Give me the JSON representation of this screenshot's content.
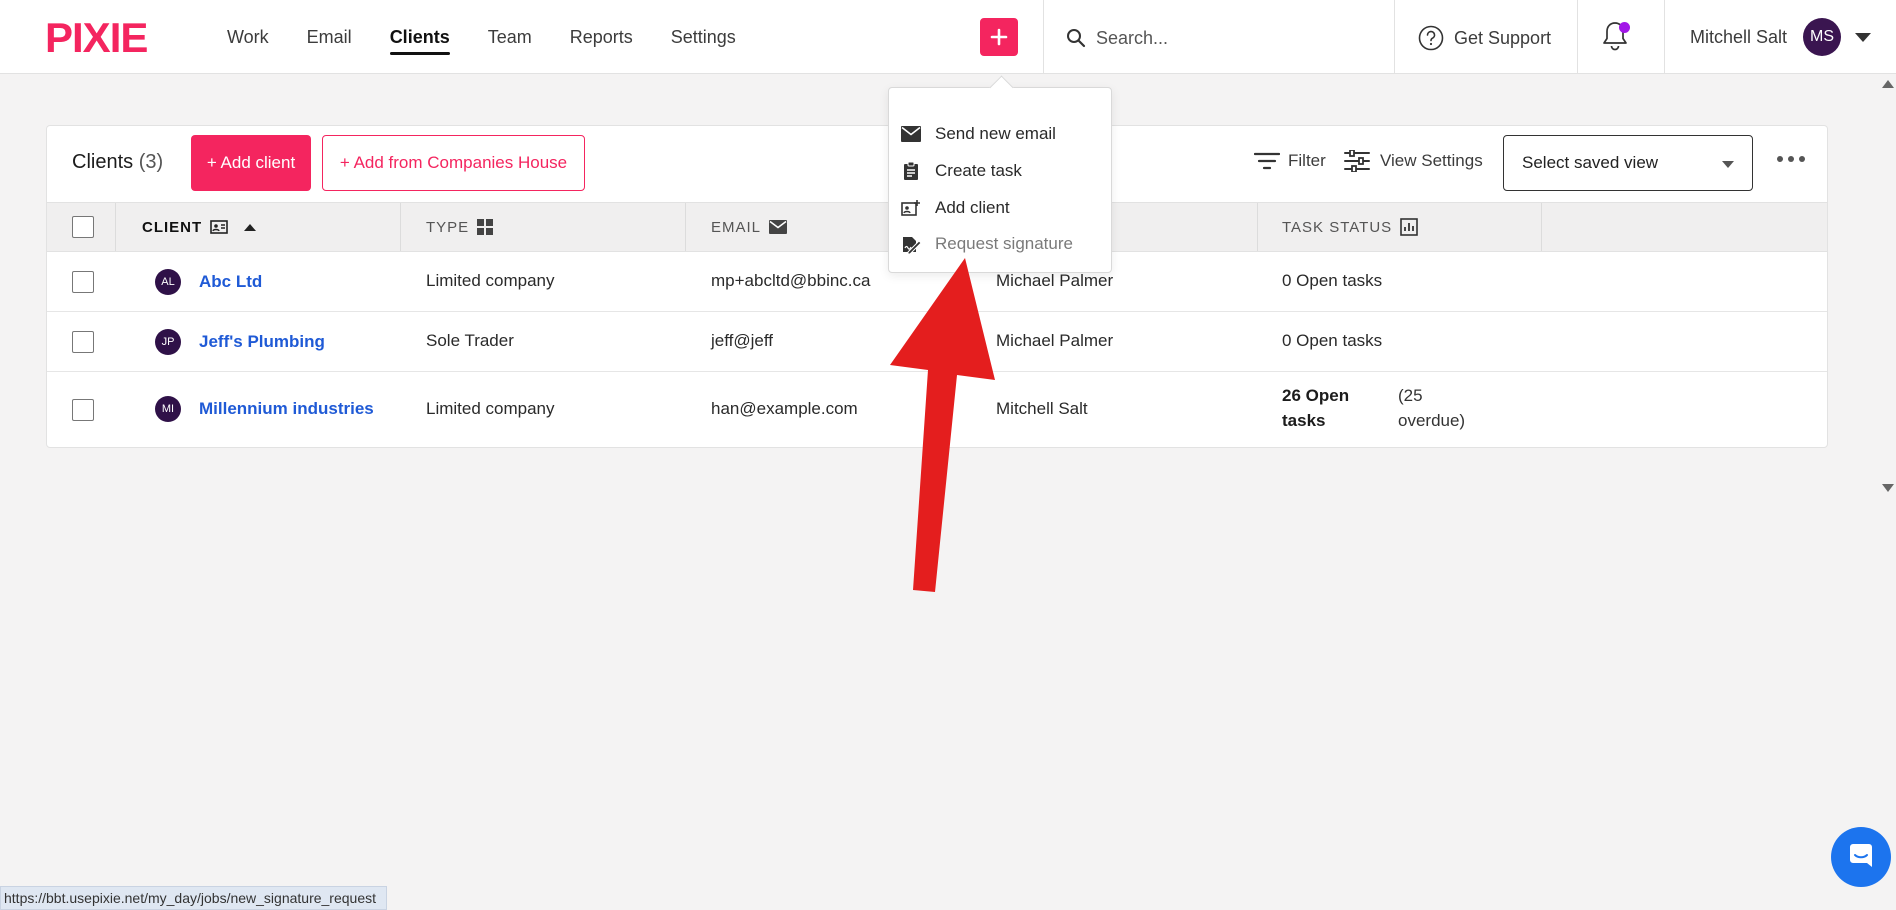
{
  "brand": {
    "logo_text": "PIXIE",
    "accent": "#f4255f",
    "link": "#1f5ad6"
  },
  "nav": {
    "items": [
      {
        "label": "Work"
      },
      {
        "label": "Email"
      },
      {
        "label": "Clients",
        "active": true
      },
      {
        "label": "Team"
      },
      {
        "label": "Reports"
      },
      {
        "label": "Settings"
      }
    ],
    "plus_icon": "plus-icon"
  },
  "search": {
    "placeholder": "Search..."
  },
  "support": {
    "label": "Get Support"
  },
  "notifications": {
    "has_unread": true
  },
  "user": {
    "name": "Mitchell Salt",
    "initials": "MS"
  },
  "clients_header": {
    "title": "Clients",
    "count": "(3)",
    "add_client": "+ Add client",
    "add_from_ch": "+ Add from Companies House",
    "filter": "Filter",
    "view_settings": "View Settings",
    "saved_view": "Select saved view"
  },
  "table": {
    "columns": [
      {
        "label": "CLIENT",
        "icon": "contact-card-icon",
        "sorted": "asc"
      },
      {
        "label": "TYPE",
        "icon": "grid-icon"
      },
      {
        "label": "EMAIL",
        "icon": "envelope-icon"
      },
      {
        "label": "",
        "icon": ""
      },
      {
        "label": "TASK STATUS",
        "icon": "bar-chart-icon"
      }
    ],
    "rows": [
      {
        "initials": "AL",
        "name": "Abc Ltd",
        "type": "Limited company",
        "email": "mp+abcltd@bbinc.ca",
        "manager": "Michael Palmer",
        "tasks": "0 Open tasks",
        "overdue": ""
      },
      {
        "initials": "JP",
        "name": "Jeff's Plumbing",
        "type": "Sole Trader",
        "email": "jeff@jeff",
        "manager": "Michael Palmer",
        "tasks": "0 Open tasks",
        "overdue": ""
      },
      {
        "initials": "MI",
        "name": "Millennium industries",
        "type": "Limited company",
        "email": "han@example.com",
        "manager": "Mitchell Salt",
        "tasks_line1": "26 Open",
        "tasks_line2": "tasks",
        "overdue_line1": "(25",
        "overdue_line2": "overdue)"
      }
    ]
  },
  "quick_menu": {
    "items": [
      {
        "label": "Send new email",
        "icon": "envelope-icon"
      },
      {
        "label": "Create task",
        "icon": "clipboard-icon"
      },
      {
        "label": "Add client",
        "icon": "add-contact-icon"
      },
      {
        "label": "Request signature",
        "icon": "signature-icon"
      }
    ]
  },
  "status_bar": {
    "url": "https://bbt.usepixie.net/my_day/jobs/new_signature_request"
  }
}
